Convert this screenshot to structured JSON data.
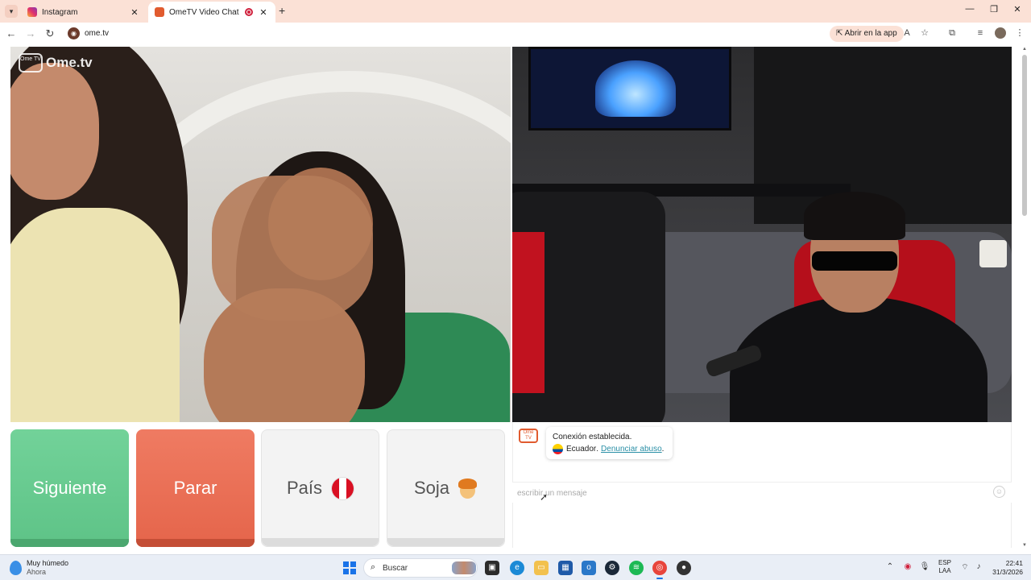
{
  "browser": {
    "tabs": [
      {
        "title": "Instagram",
        "active": false,
        "favicon": "instagram-icon"
      },
      {
        "title": "OmeTV Video Chat — Alter",
        "active": true,
        "favicon": "ometv-icon",
        "recording": true
      }
    ],
    "new_tab_label": "+",
    "url": "ome.tv",
    "open_in_app_label": "Abrir en la app",
    "window_controls": {
      "minimize": "—",
      "restore": "❐",
      "close": "✕"
    }
  },
  "page": {
    "logo_text": "Ome.tv",
    "logo_badge": "Ome TV",
    "controls": {
      "next_label": "Siguiente",
      "stop_label": "Parar",
      "country_label": "País",
      "country_flag": "peru-flag-icon",
      "gender_label": "Soja",
      "gender_icon": "boy-emoji-icon"
    },
    "chat": {
      "system_message": {
        "line1": "Conexión establecida.",
        "country": "Ecuador",
        "separator": " .",
        "report_link": "Denunciar abuso",
        "trailing": "."
      },
      "input_placeholder": "escribir un mensaje",
      "emoji_icon": "☺"
    },
    "colors": {
      "next": "#5ec387",
      "stop": "#e5654b",
      "neutral": "#f3f3f3",
      "link": "#2a8fa6",
      "brand": "#e15b2f"
    }
  },
  "taskbar": {
    "weather_title": "Muy húmedo",
    "weather_sub": "Ahora",
    "search_label": "Buscar",
    "language_line1": "ESP",
    "language_line2": "LAA",
    "time": "22:41",
    "date": "31/3/2026"
  }
}
